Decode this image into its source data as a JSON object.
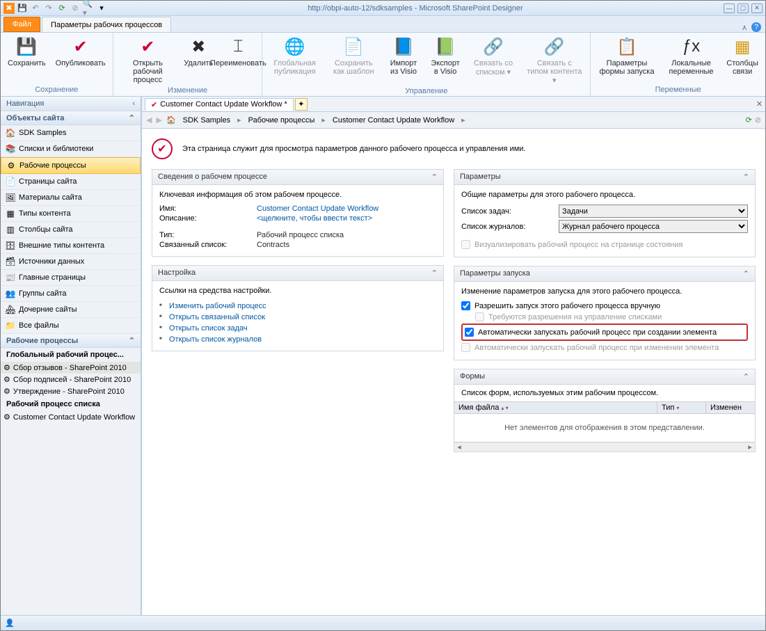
{
  "window": {
    "title": "http://obpi-auto-12/sdksamples  -  Microsoft SharePoint Designer"
  },
  "tabs": {
    "file": "Файл",
    "active": "Параметры рабочих процессов"
  },
  "ribbon": {
    "groups": [
      {
        "label": "Сохранение",
        "buttons": [
          {
            "label": "Сохранить",
            "icon": "💾"
          },
          {
            "label": "Опубликовать",
            "icon": "✔"
          }
        ]
      },
      {
        "label": "Изменение",
        "buttons": [
          {
            "label": "Открыть рабочий процесс",
            "icon": "✔"
          },
          {
            "label": "Удалить",
            "icon": "✖"
          },
          {
            "label": "Переименовать",
            "icon": "⌶"
          }
        ]
      },
      {
        "label": "Управление",
        "buttons": [
          {
            "label": "Глобальная публикация",
            "icon": "🌐",
            "dis": true
          },
          {
            "label": "Сохранить как шаблон",
            "icon": "📄",
            "dis": true
          },
          {
            "label": "Импорт из Visio",
            "icon": "📘"
          },
          {
            "label": "Экспорт в Visio",
            "icon": "📗"
          },
          {
            "label": "Связать со списком ▾",
            "icon": "🔗",
            "dis": true
          },
          {
            "label": "Связать с типом контента ▾",
            "icon": "🔗",
            "dis": true
          }
        ]
      },
      {
        "label": "Переменные",
        "buttons": [
          {
            "label": "Параметры формы запуска",
            "icon": "📋"
          },
          {
            "label": "Локальные переменные",
            "icon": "ƒx"
          },
          {
            "label": "Столбцы связи",
            "icon": "▦"
          }
        ]
      }
    ]
  },
  "nav": {
    "title": "Навигация",
    "objects_title": "Объекты сайта",
    "items": [
      {
        "label": "SDK Samples",
        "icon": "🏠"
      },
      {
        "label": "Списки и библиотеки",
        "icon": "📚"
      },
      {
        "label": "Рабочие процессы",
        "icon": "⚙",
        "sel": true
      },
      {
        "label": "Страницы сайта",
        "icon": "📄"
      },
      {
        "label": "Материалы сайта",
        "icon": "🖼"
      },
      {
        "label": "Типы контента",
        "icon": "▦"
      },
      {
        "label": "Столбцы сайта",
        "icon": "▥"
      },
      {
        "label": "Внешние типы контента",
        "icon": "🗄"
      },
      {
        "label": "Источники данных",
        "icon": "🗃"
      },
      {
        "label": "Главные страницы",
        "icon": "📰"
      },
      {
        "label": "Группы сайта",
        "icon": "👥"
      },
      {
        "label": "Дочерние сайты",
        "icon": "🏘"
      },
      {
        "label": "Все файлы",
        "icon": "📁"
      }
    ],
    "wf_title": "Рабочие процессы",
    "wf_global": "Глобальный рабочий процес...",
    "wf_items": [
      {
        "label": "Сбор отзывов - SharePoint 2010",
        "sel": true
      },
      {
        "label": "Сбор подписей - SharePoint 2010"
      },
      {
        "label": "Утверждение - SharePoint 2010"
      }
    ],
    "wf_list_hdr": "Рабочий процесс списка",
    "wf_list_item": "Customer Contact Update Workflow"
  },
  "doc": {
    "tab": "Customer Contact Update Workflow *",
    "crumbs": [
      "SDK Samples",
      "Рабочие процессы",
      "Customer Contact Update Workflow"
    ]
  },
  "intro": "Эта страница служит для просмотра параметров данного рабочего процесса и управления ими.",
  "p_info": {
    "title": "Сведения о рабочем процессе",
    "sub": "Ключевая информация об этом рабочем процессе.",
    "name_k": "Имя:",
    "name_v": "Customer Contact Update Workflow",
    "desc_k": "Описание:",
    "desc_v": "<щелкните, чтобы ввести текст>",
    "type_k": "Тип:",
    "type_v": "Рабочий процесс списка",
    "list_k": "Связанный список:",
    "list_v": "Contracts"
  },
  "p_cfg": {
    "title": "Настройка",
    "sub": "Ссылки на средства настройки.",
    "links": [
      "Изменить рабочий процесс",
      "Открыть связанный список",
      "Открыть список задач",
      "Открыть список журналов"
    ]
  },
  "p_params": {
    "title": "Параметры",
    "sub": "Общие параметры для этого рабочего процесса.",
    "task_k": "Список задач:",
    "task_v": "Задачи",
    "log_k": "Список журналов:",
    "log_v": "Журнал рабочего процесса",
    "viz": "Визуализировать рабочий процесс на странице состояния"
  },
  "p_start": {
    "title": "Параметры запуска",
    "sub": "Изменение параметров запуска для этого рабочего процесса.",
    "c1": "Разрешить запуск этого рабочего процесса вручную",
    "c1a": "Требуются разрешения на управление списками",
    "c2": "Автоматически запускать рабочий процесс при создании элемента",
    "c3": "Автоматически запускать рабочий процесс при изменении элемента"
  },
  "p_forms": {
    "title": "Формы",
    "sub": "Список форм, используемых этим рабочим процессом.",
    "cols": [
      "Имя файла",
      "Тип",
      "Изменен"
    ],
    "empty": "Нет элементов для отображения в этом представлении."
  }
}
